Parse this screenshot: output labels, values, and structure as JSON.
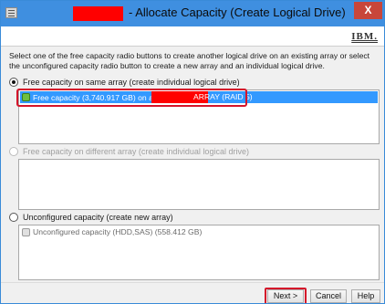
{
  "window": {
    "title": "- Allocate Capacity (Create Logical Drive)",
    "close_glyph": "X"
  },
  "header": {
    "logo_text": "IBM."
  },
  "instructions": "Select one of the free capacity radio buttons to create another logical drive on an existing array or select the unconfigured capacity radio button to create a new array and an individual logical drive.",
  "options": {
    "same_array": {
      "label": "Free capacity on same array (create individual logical drive)",
      "selected": true,
      "item_label": "Free capacity (3,740.917 GB) on array",
      "item_suffix": "ARRAY (RAID 5)"
    },
    "different_array": {
      "label": "Free capacity on different array (create individual logical drive)",
      "selected": false,
      "disabled": true
    },
    "unconfigured": {
      "label": "Unconfigured capacity (create new array)",
      "selected": false,
      "item_label": "Unconfigured capacity (HDD,SAS) (558.412 GB)"
    }
  },
  "buttons": {
    "next": "Next >",
    "cancel": "Cancel",
    "help": "Help"
  },
  "icons": {
    "app": "window-app-icon",
    "drive_green": "drive-icon",
    "drive_gray": "drive-icon"
  },
  "colors": {
    "titlebar": "#3f8fe0",
    "redaction": "#ff0000",
    "selection": "#3399ff",
    "highlight_outline": "#d4142a"
  }
}
